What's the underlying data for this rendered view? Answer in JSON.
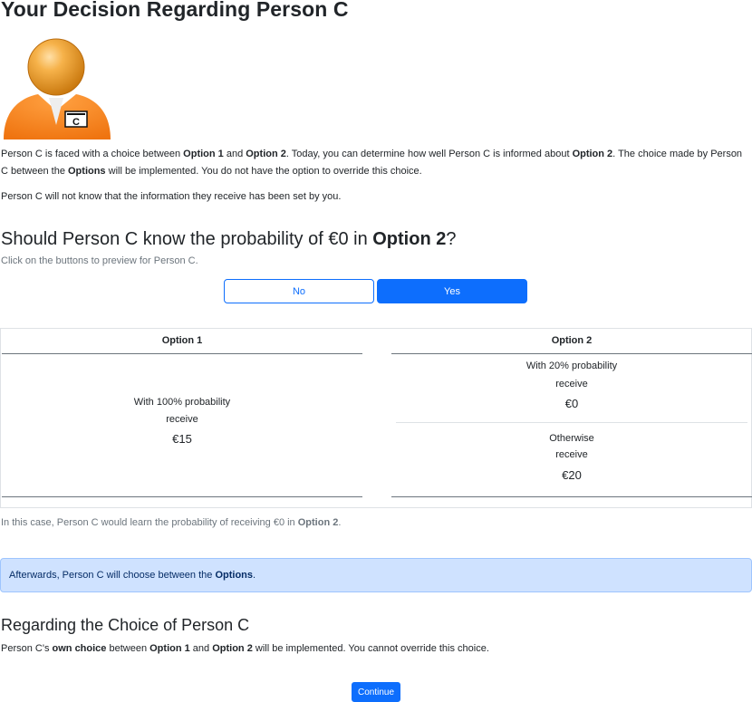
{
  "page": {
    "title": "Your Decision Regarding Person C",
    "avatar_label": "C"
  },
  "intro": {
    "p1_a": "Person C is faced with a choice between ",
    "p1_option1": "Option 1",
    "p1_and": " and ",
    "p1_option2": "Option 2",
    "p1_b": ". Today, you can determine how well Person C is informed about ",
    "p1_option2b": "Option 2",
    "p1_c": ". The choice made by Person C between the ",
    "p1_options": "Options",
    "p1_d": " will be implemented. You do not have the option to override this choice.",
    "p2": "Person C will not know that the information they receive has been set by you."
  },
  "question": {
    "heading_a": "Should Person C know the probability of €0 in ",
    "heading_bold": "Option 2",
    "heading_b": "?",
    "hint": "Click on the buttons to preview for Person C.",
    "no_label": "No",
    "yes_label": "Yes",
    "selected": "Yes"
  },
  "table": {
    "option1": {
      "header": "Option 1",
      "line1": "With 100% probability",
      "line2": "receive",
      "amount": "€15"
    },
    "option2": {
      "header": "Option 2",
      "a_line1": "With 20% probability",
      "a_line2": "receive",
      "a_amount": "€0",
      "b_line1": "Otherwise",
      "b_line2": "receive",
      "b_amount": "€20"
    }
  },
  "case_note": {
    "text_a": "In this case, Person C would learn the probability of receiving €0 in ",
    "bold": "Option 2",
    "text_b": "."
  },
  "alert": {
    "text_a": "Afterwards, Person C will choose between the ",
    "bold": "Options",
    "text_b": "."
  },
  "choice": {
    "heading": "Regarding the Choice of Person C",
    "text_a": "Person C's ",
    "bold1": "own choice",
    "text_b": " between ",
    "bold2": "Option 1",
    "text_c": " and ",
    "bold3": "Option 2",
    "text_d": " will be implemented. You cannot override this choice."
  },
  "continue_label": "Continue",
  "colors": {
    "primary": "#0d6efd",
    "alert_bg": "#cfe2ff",
    "avatar_orange": "#f58220"
  }
}
